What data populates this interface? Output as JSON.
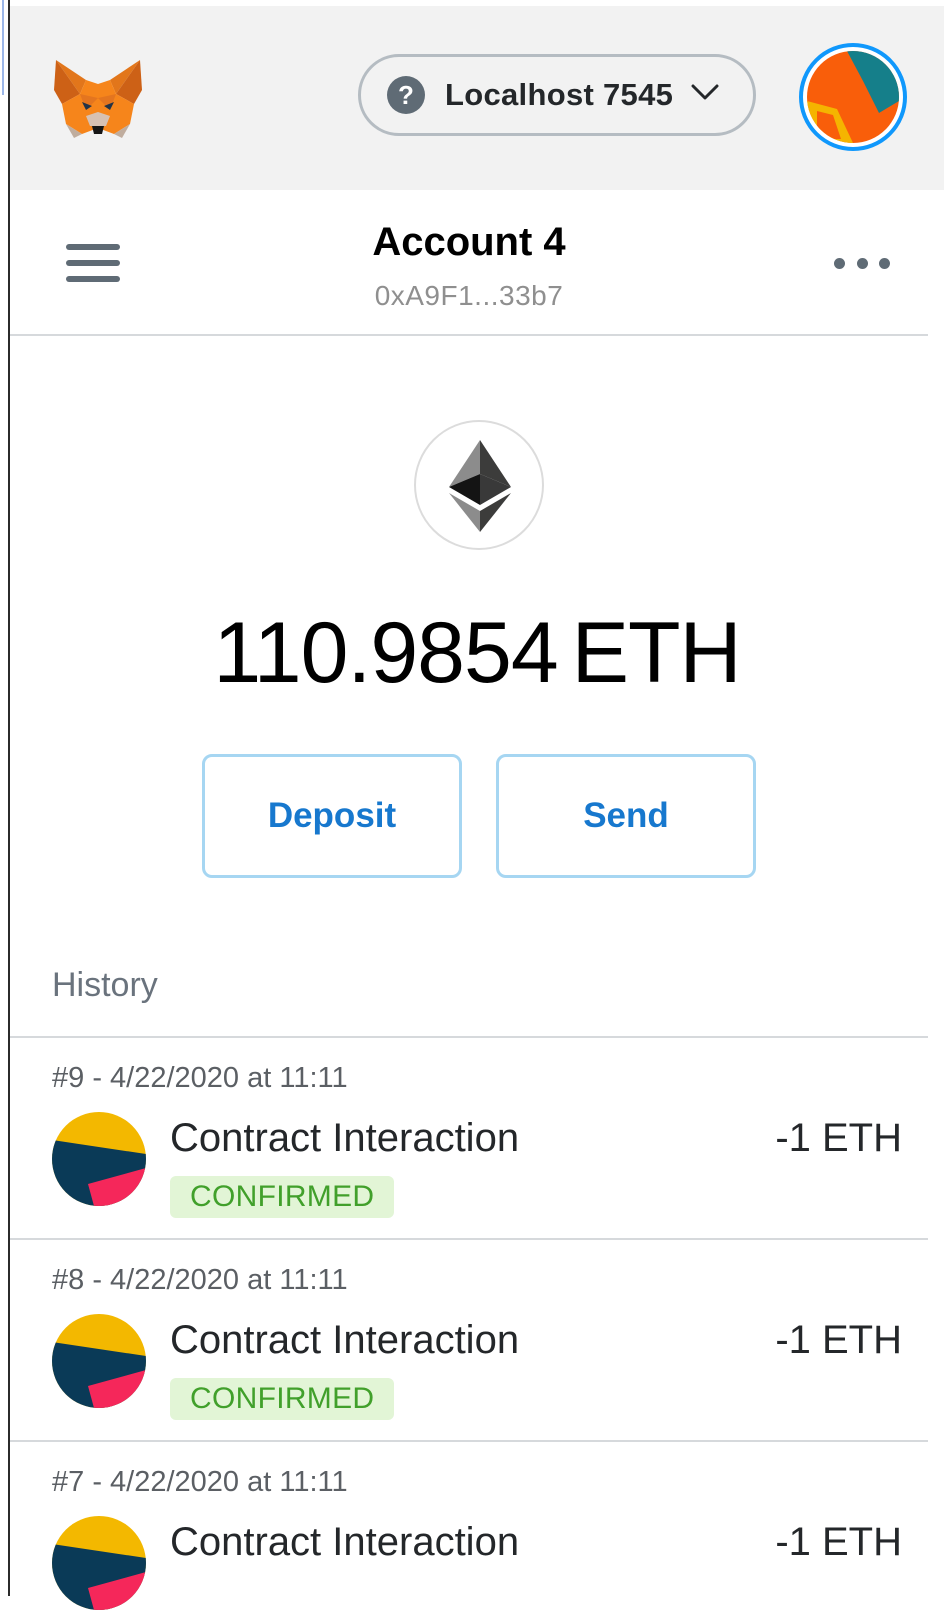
{
  "header": {
    "network_label": "Localhost 7545",
    "network_help_glyph": "?",
    "logo_icon": "metamask-fox-icon",
    "account_icon": "identicon"
  },
  "account": {
    "name": "Account 4",
    "address": "0xA9F1...33b7"
  },
  "balance": {
    "amount": "110.9854",
    "unit": "ETH"
  },
  "actions": {
    "deposit_label": "Deposit",
    "send_label": "Send"
  },
  "history": {
    "title": "History",
    "items": [
      {
        "date": "#9 - 4/22/2020 at 11:11",
        "title": "Contract Interaction",
        "status": "CONFIRMED",
        "amount": "-1 ETH"
      },
      {
        "date": "#8 - 4/22/2020 at 11:11",
        "title": "Contract Interaction",
        "status": "CONFIRMED",
        "amount": "-1 ETH"
      },
      {
        "date": "#7 - 4/22/2020 at 11:11",
        "title": "Contract Interaction",
        "status": "",
        "amount": "-1 ETH"
      }
    ]
  },
  "colors": {
    "accent_blue": "#1778ce",
    "button_border": "#a6d6f2",
    "confirmed_green": "#41a02b",
    "confirmed_bg": "#e2f5d6"
  }
}
